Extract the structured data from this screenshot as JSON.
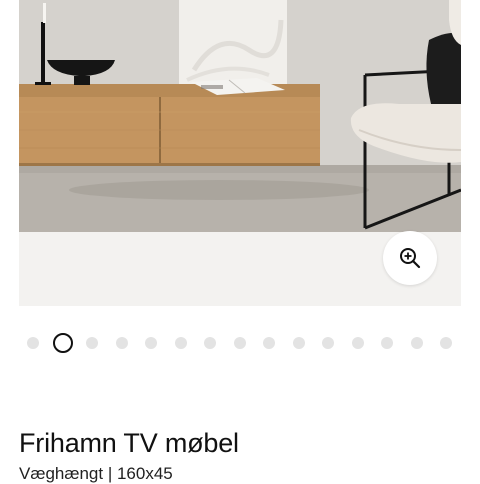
{
  "product": {
    "title": "Frihamn TV møbel",
    "subtitle": "Væghængt | 160x45"
  },
  "gallery": {
    "image_count": 15,
    "active_index": 1,
    "zoom_icon": "zoom-in-icon"
  },
  "colors": {
    "dot_inactive": "#e3e3e3",
    "dot_active_border": "#111111",
    "gallery_background": "#f3f2f0"
  }
}
